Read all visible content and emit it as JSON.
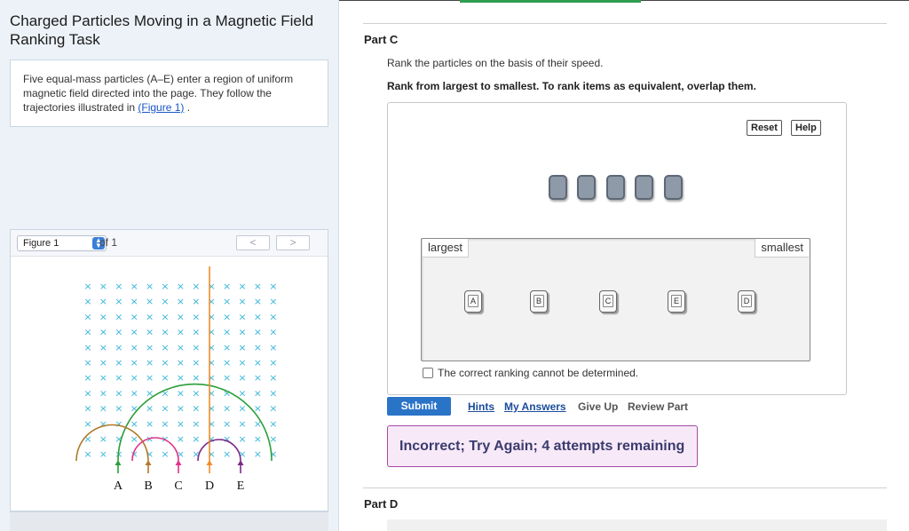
{
  "assignment": {
    "title_line1": "Charged Particles Moving in a Magnetic Field",
    "title_line2": "Ranking Task"
  },
  "intro": {
    "text": "Five equal-mass particles (A–E) enter a region of uniform magnetic field directed into the page. They follow the trajectories illustrated in ",
    "link": "(Figure 1)",
    "after": " ."
  },
  "figure": {
    "selector_value": "Figure 1",
    "of_text": "of 1",
    "prev_glyph": "<",
    "next_glyph": ">",
    "field_symbol": "×",
    "particles": [
      "A",
      "B",
      "C",
      "D",
      "E"
    ],
    "colors": {
      "field": "#38b6d8",
      "A": "#2a9e3a",
      "B": "#b07a2a",
      "C": "#e0338a",
      "D": "#f08c2a",
      "E": "#7a2a8a"
    }
  },
  "part_c": {
    "label": "Part C",
    "question": "Rank the particles on the basis of their speed.",
    "instruction": "Rank from largest to smallest. To rank items as equivalent, overlap them.",
    "reset_label": "Reset",
    "help_label": "Help",
    "largest_label": "largest",
    "smallest_label": "smallest",
    "ranked_tiles": [
      "A",
      "B",
      "C",
      "E",
      "D"
    ],
    "cannot_determine": "The correct ranking cannot be determined.",
    "cannot_checked": false
  },
  "actions": {
    "submit": "Submit",
    "hints": "Hints",
    "my_answers": "My Answers",
    "give_up": "Give Up",
    "review_part": "Review Part"
  },
  "feedback": {
    "message": "Incorrect; Try Again; 4 attempts remaining",
    "color": "#a64aa6"
  },
  "part_d": {
    "label": "Part D"
  }
}
